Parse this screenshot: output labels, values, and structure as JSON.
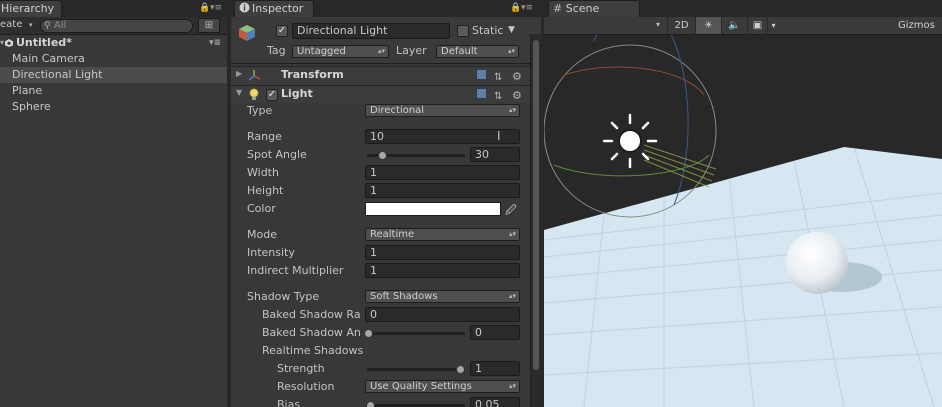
{
  "hierarchy": {
    "tab_label": "Hierarchy",
    "create_label": "eate",
    "search_placeholder": "All",
    "scene_name": "Untitled*",
    "objects": [
      "Main Camera",
      "Directional Light",
      "Plane",
      "Sphere"
    ],
    "selected_index": 1
  },
  "inspector": {
    "tab_label": "Inspector",
    "object_name": "Directional Light",
    "active_checked": true,
    "static_label": "Static",
    "tag_label": "Tag",
    "tag_value": "Untagged",
    "layer_label": "Layer",
    "layer_value": "Default",
    "transform_label": "Transform",
    "light_label": "Light",
    "light_enabled": true,
    "properties": {
      "type": {
        "label": "Type",
        "value": "Directional"
      },
      "range": {
        "label": "Range",
        "value": "10"
      },
      "spot_angle": {
        "label": "Spot Angle",
        "value": "30",
        "fraction": 0.09
      },
      "width": {
        "label": "Width",
        "value": "1"
      },
      "height": {
        "label": "Height",
        "value": "1"
      },
      "color": {
        "label": "Color",
        "value": "#ffffff"
      },
      "mode": {
        "label": "Mode",
        "value": "Realtime"
      },
      "intensity": {
        "label": "Intensity",
        "value": "1"
      },
      "indirect_multiplier": {
        "label": "Indirect Multiplier",
        "value": "1"
      },
      "shadow_type": {
        "label": "Shadow Type",
        "value": "Soft Shadows"
      },
      "baked_shadow_radius": {
        "label": "Baked Shadow Ra",
        "value": "0"
      },
      "baked_shadow_angle": {
        "label": "Baked Shadow An",
        "value": "0",
        "fraction": 0.0
      },
      "realtime_shadows": {
        "label": "Realtime Shadows"
      },
      "strength": {
        "label": "Strength",
        "value": "1",
        "fraction": 1.0
      },
      "resolution": {
        "label": "Resolution",
        "value": "Use Quality Settings"
      },
      "bias": {
        "label": "Bias",
        "value": "0.05",
        "fraction": 0.02
      }
    }
  },
  "scene": {
    "tab_label": "Scene",
    "toggle_2d": "2D",
    "gizmos_label": "Gizmos",
    "colors": {
      "sky": "#282828",
      "ground": "#d6e7f2",
      "grid": "#b9cfdf"
    }
  }
}
